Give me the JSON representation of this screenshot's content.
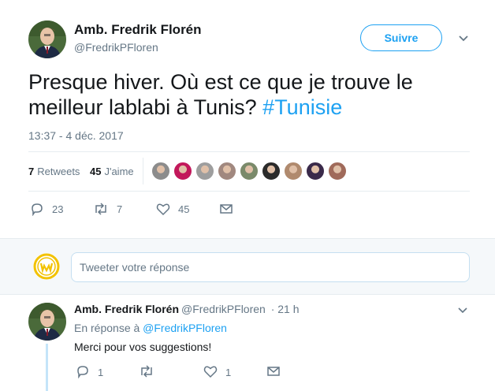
{
  "tweet": {
    "author_name": "Amb. Fredrik Florén",
    "author_handle": "@FredrikPFloren",
    "follow_label": "Suivre",
    "text_main": "Presque hiver. Où est ce que je trouve le meilleur lablabi à Tunis? ",
    "hashtag": "#Tunisie",
    "timestamp": "13:37 - 4 déc. 2017",
    "retweets_count": "7",
    "retweets_label": "Retweets",
    "likes_count": "45",
    "likes_label": "J'aime",
    "actions": {
      "reply_count": "23",
      "retweet_count": "7",
      "like_count": "45"
    },
    "liker_avatar_colors": [
      "#8c8c8c",
      "#c2185b",
      "#9e9e9e",
      "#a1887f",
      "#7a8a6a",
      "#2b2b2b",
      "#b08a6e",
      "#3a2a4a",
      "#a06a5a"
    ]
  },
  "reply_box": {
    "placeholder": "Tweeter votre réponse"
  },
  "reply": {
    "author_name": "Amb. Fredrik Florén",
    "author_handle": "@FredrikPFloren",
    "time": "· 21 h",
    "in_reply_prefix": "En réponse à ",
    "in_reply_handle": "@FredrikPFloren",
    "text": "Merci pour vos suggestions!",
    "actions": {
      "reply_count": "1",
      "retweet_count": "",
      "like_count": "1"
    }
  },
  "colors": {
    "accent": "#1da1f2",
    "muted": "#657786",
    "text": "#14171a",
    "divider": "#e6ecf0",
    "reply_bg": "#f5f8fa"
  }
}
